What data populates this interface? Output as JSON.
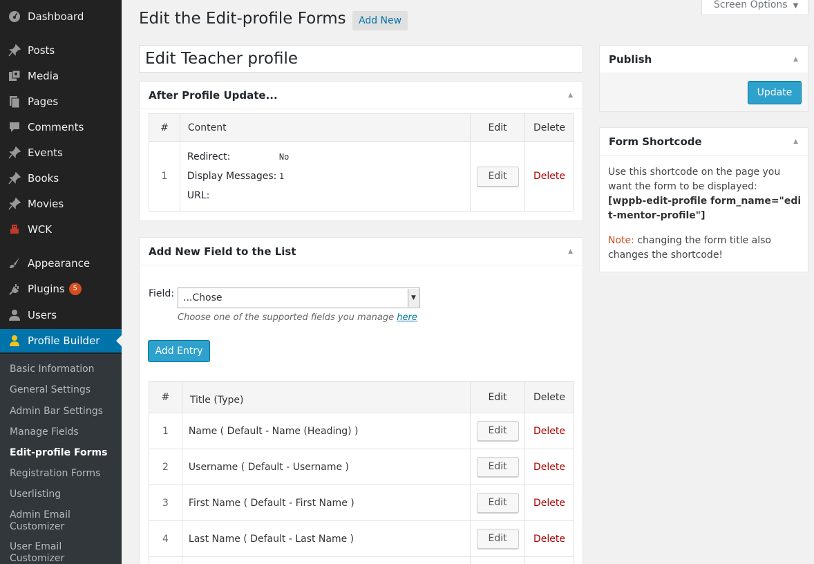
{
  "sidebar": {
    "items": [
      {
        "label": "Dashboard",
        "icon": "dashboard-icon"
      },
      {
        "label": "Posts",
        "icon": "pin-icon"
      },
      {
        "label": "Media",
        "icon": "media-icon"
      },
      {
        "label": "Pages",
        "icon": "pages-icon"
      },
      {
        "label": "Comments",
        "icon": "comment-icon"
      },
      {
        "label": "Events",
        "icon": "pin-icon"
      },
      {
        "label": "Books",
        "icon": "pin-icon"
      },
      {
        "label": "Movies",
        "icon": "pin-icon"
      },
      {
        "label": "WCK",
        "icon": "robot-icon"
      },
      {
        "label": "Appearance",
        "icon": "brush-icon"
      },
      {
        "label": "Plugins",
        "icon": "plug-icon",
        "badge": "5"
      },
      {
        "label": "Users",
        "icon": "user-icon"
      },
      {
        "label": "Profile Builder",
        "icon": "profile-user-icon"
      }
    ],
    "submenu": [
      "Basic Information",
      "General Settings",
      "Admin Bar Settings",
      "Manage Fields",
      "Edit-profile Forms",
      "Registration Forms",
      "Userlisting",
      "Admin Email Customizer",
      "User Email Customizer"
    ]
  },
  "header": {
    "title": "Edit the Edit-profile Forms",
    "add_new": "Add New",
    "screen_options": "Screen Options"
  },
  "form_title": "Edit Teacher profile",
  "after_update": {
    "title": "After Profile Update...",
    "columns": [
      "#",
      "Content",
      "Edit",
      "Delete"
    ],
    "row": {
      "num": "1",
      "redirect_label": "Redirect:",
      "redirect_value": "No",
      "messages_label": "Display Messages:",
      "messages_value": "1",
      "url_label": "URL:",
      "edit": "Edit",
      "delete": "Delete"
    }
  },
  "add_field": {
    "title": "Add New Field to the List",
    "field_label": "Field:",
    "select_value": "...Chose",
    "hint": "Choose one of the supported fields you manage",
    "hint_link": "here",
    "add_entry": "Add Entry",
    "columns": [
      "#",
      "Title (Type)",
      "Edit",
      "Delete"
    ],
    "rows": [
      {
        "num": "1",
        "title": "Name ( Default - Name (Heading) )",
        "edit": "Edit",
        "delete": "Delete"
      },
      {
        "num": "2",
        "title": "Username ( Default - Username )",
        "edit": "Edit",
        "delete": "Delete"
      },
      {
        "num": "3",
        "title": "First Name ( Default - First Name )",
        "edit": "Edit",
        "delete": "Delete"
      },
      {
        "num": "4",
        "title": "Last Name ( Default - Last Name )",
        "edit": "Edit",
        "delete": "Delete"
      }
    ]
  },
  "publish": {
    "title": "Publish",
    "update": "Update"
  },
  "shortcode": {
    "title": "Form Shortcode",
    "text1": "Use this shortcode on the page you want the form to be displayed:",
    "code": "[wppb-edit-profile form_name=\"edit-mentor-profile\"]",
    "note_label": "Note:",
    "note_text": "changing the form title also changes the shortcode!"
  },
  "colors": {
    "sidebar_bg": "#222222",
    "submenu_bg": "#32373c",
    "accent": "#0073aa",
    "button_primary": "#2ea2cc",
    "delete_red": "#aa0000",
    "badge": "#d54e21"
  }
}
